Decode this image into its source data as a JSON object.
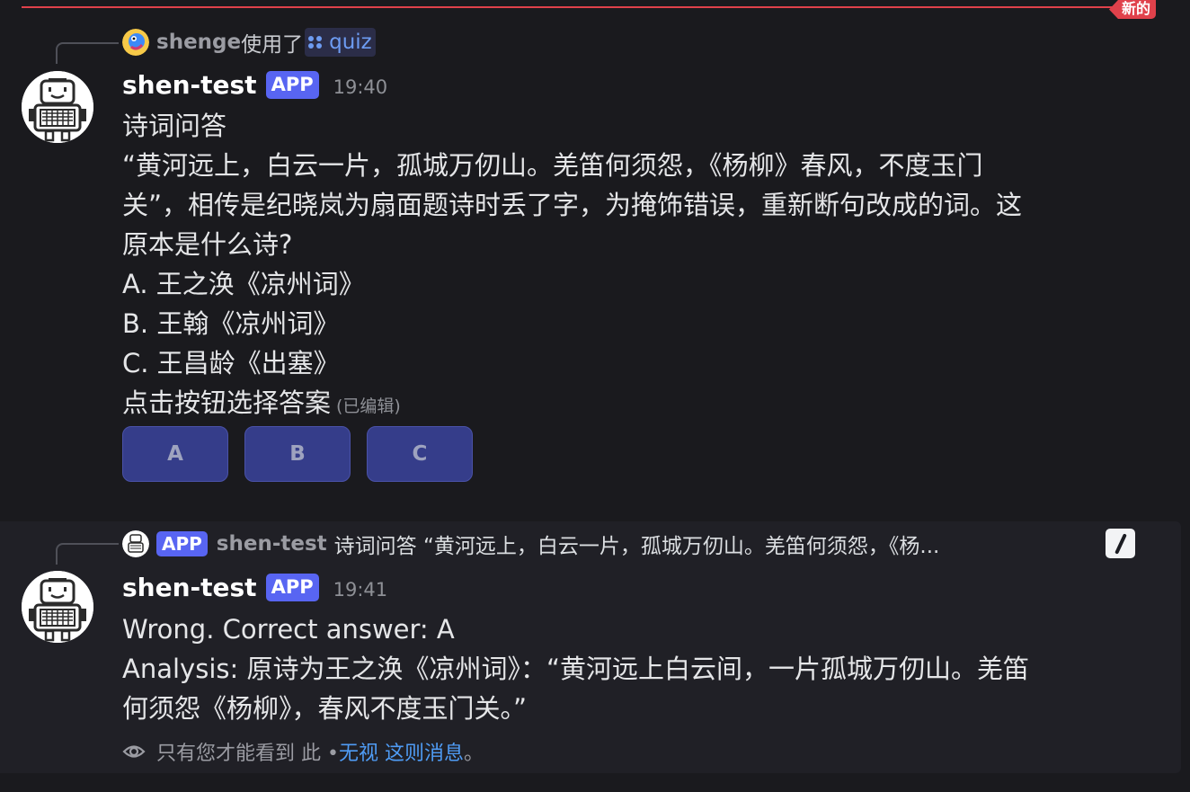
{
  "divider": {
    "label": "新的",
    "color": "#e0414b"
  },
  "messages": [
    {
      "reply": {
        "user": "shenge",
        "action": "使用了",
        "command_icon": "grid-icon",
        "command": "quiz"
      },
      "author": "shen-test",
      "badge": "APP",
      "time": "19:40",
      "lines": [
        "诗词问答",
        "“黄河远上，白云一片，孤城万仞山。羌笛何须怨，《杨柳》春风，不度玉门",
        "关”，相传是纪晓岚为扇面题诗时丢了字，为掩饰错误，重新断句改成的词。这",
        "原本是什么诗?",
        "A. 王之涣《凉州词》",
        "B. 王翰《凉州词》",
        "C. 王昌龄《出塞》",
        "点击按钮选择答案"
      ],
      "edited_label": "(已编辑)",
      "buttons": [
        "A",
        "B",
        "C"
      ]
    },
    {
      "reply": {
        "badge": "APP",
        "user": "shen-test",
        "preview": "诗词问答 “黄河远上，白云一片，孤城万仞山。羌笛何须怨，《杨..."
      },
      "author": "shen-test",
      "badge": "APP",
      "time": "19:41",
      "lines": [
        "Wrong. Correct answer: A",
        "Analysis: 原诗为王之涣《凉州词》：“黄河远上白云间，一片孤城万仞山。羌笛",
        "何须怨《杨柳》，春风不度玉门关。”"
      ],
      "ephemeral": {
        "text": "只有您才能看到 此 • ",
        "link": "无视 这则消息",
        "suffix": "。"
      }
    }
  ],
  "colors": {
    "background": "#1a1a1e",
    "highlight": "#202026",
    "accent": "#5865f2",
    "button": "#353d8a",
    "link": "#4f9cf5"
  }
}
